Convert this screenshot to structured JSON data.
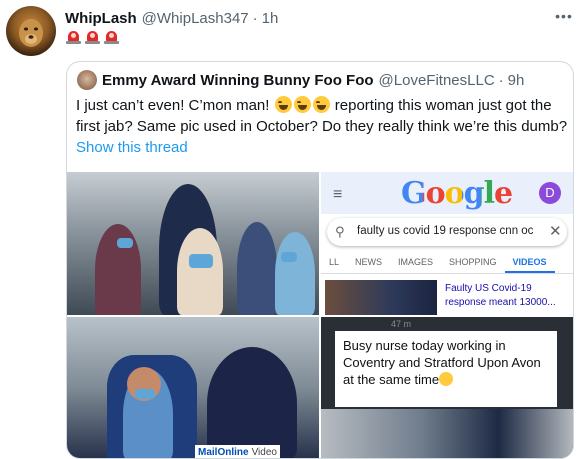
{
  "tweet": {
    "name": "WhipLash",
    "handle": "@WhipLash347",
    "separator": "·",
    "time": "1h",
    "more": "•••"
  },
  "quoted": {
    "name": "Emmy Award Winning Bunny Foo Foo",
    "handle": "@LoveFitnesLLC",
    "separator": "·",
    "time": "9h",
    "text_part1": "I just can’t even! C’mon man! ",
    "text_part2": " reporting this woman just got the first jab? Same pic used in October? Do they really think we’re this dumb?",
    "show_thread": "Show this thread"
  },
  "google": {
    "logo": "Google",
    "avatar_letter": "D",
    "query": "faulty us covid 19 response cnn oc",
    "tabs": [
      "LL",
      "NEWS",
      "IMAGES",
      "SHOPPING",
      "VIDEOS"
    ],
    "active_tab": "VIDEOS",
    "result_title": "Faulty US Covid-19 response meant 13000..."
  },
  "meme": {
    "caption": "Busy nurse today working in Coventry and Stratford Upon Avon at the same time",
    "top_text": "47 m"
  },
  "watermark": {
    "brand": "MailOnline",
    "label": "Video"
  },
  "colors": {
    "link": "#1d9bf0",
    "secondary_text": "#536471",
    "border": "#cfd9de"
  }
}
